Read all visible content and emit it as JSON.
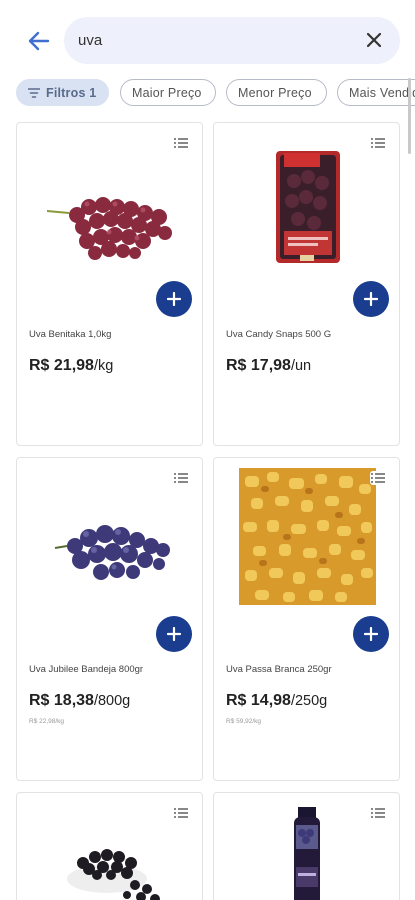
{
  "search": {
    "query": "uva"
  },
  "chips": [
    {
      "label": "Filtros 1",
      "active": true
    },
    {
      "label": "Maior Preço",
      "active": false
    },
    {
      "label": "Menor Preço",
      "active": false
    },
    {
      "label": "Mais Vendidos",
      "active": false
    }
  ],
  "products": [
    {
      "name": "Uva Benitaka 1,0kg",
      "price": "R$ 21,98",
      "unit": "/kg",
      "sub": "",
      "image": "red-grapes"
    },
    {
      "name": "Uva Candy Snaps 500 G",
      "price": "R$ 17,98",
      "unit": "/un",
      "sub": "",
      "image": "grape-package"
    },
    {
      "name": "Uva Jubilee Bandeja 800gr",
      "price": "R$ 18,38",
      "unit": "/800g",
      "sub": "R$ 22,98/kg",
      "image": "purple-grapes"
    },
    {
      "name": "Uva Passa Branca 250gr",
      "price": "R$ 14,98",
      "unit": "/250g",
      "sub": "R$ 59,92/kg",
      "image": "golden-raisins"
    },
    {
      "name": "",
      "price": "",
      "unit": "",
      "sub": "",
      "image": "dark-raisins-bowl"
    },
    {
      "name": "",
      "price": "",
      "unit": "",
      "sub": "",
      "image": "juice-bottle"
    }
  ],
  "colors": {
    "accent": "#1a3d8f",
    "search_bg": "#eef1fb",
    "chip_active_bg": "#d9e2f2",
    "back_arrow": "#3f6fd1"
  },
  "icons": {
    "back": "arrow-left-icon",
    "clear": "close-icon",
    "filter": "filter-icon",
    "list": "list-icon",
    "add": "plus-icon"
  }
}
